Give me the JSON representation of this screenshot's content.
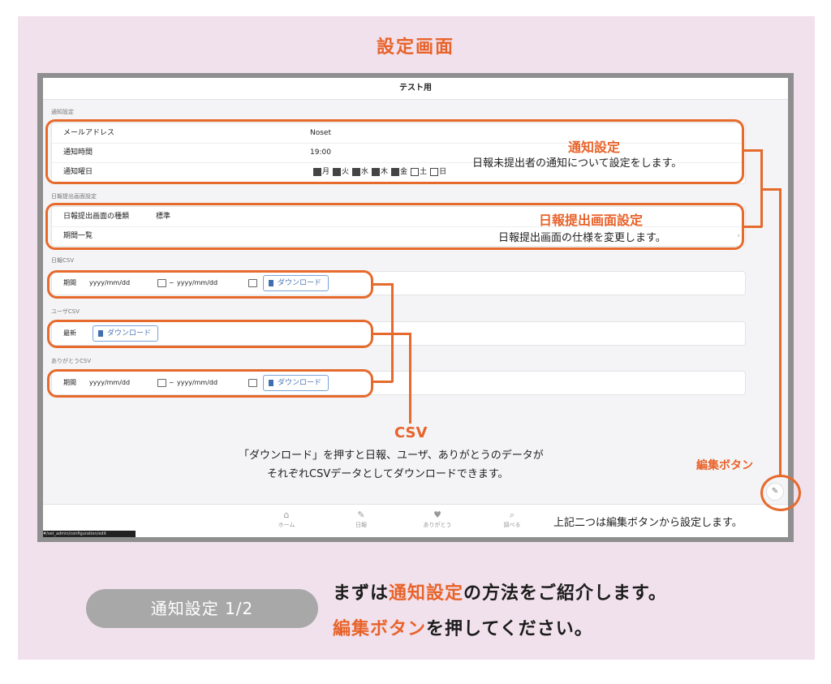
{
  "page_title": "設定画面",
  "colors": {
    "accent": "#e8632a",
    "panel": "#f1e1ec",
    "frame": "#8f8f8f"
  },
  "app": {
    "header_title": "テスト用",
    "notification": {
      "section_label": "通知設定",
      "rows": [
        {
          "label": "メールアドレス",
          "value": "Noset"
        },
        {
          "label": "通知時間",
          "value": "19:00"
        },
        {
          "label": "通知曜日",
          "days": [
            {
              "day": "月",
              "checked": true
            },
            {
              "day": "火",
              "checked": true
            },
            {
              "day": "水",
              "checked": true
            },
            {
              "day": "木",
              "checked": true
            },
            {
              "day": "金",
              "checked": true
            },
            {
              "day": "土",
              "checked": false
            },
            {
              "day": "日",
              "checked": false
            }
          ]
        }
      ]
    },
    "report_screen": {
      "section_label": "日報提出画面設定",
      "type_label": "日報提出画面の種類",
      "type_value": "標準",
      "period_list_label": "期間一覧",
      "chevron": "›"
    },
    "csv": {
      "date_placeholder": "yyyy/mm/dd",
      "tilde": "~",
      "download_label": "ダウンロード",
      "daily": {
        "section_label": "日報CSV",
        "row_label": "期間"
      },
      "user": {
        "section_label": "ユーザCSV",
        "row_label": "最新"
      },
      "thanks": {
        "section_label": "ありがとうCSV",
        "row_label": "期間"
      }
    },
    "bottom_nav": [
      {
        "icon": "home-icon",
        "glyph": "⌂",
        "label": "ホーム"
      },
      {
        "icon": "report-icon",
        "glyph": "✎",
        "label": "日報"
      },
      {
        "icon": "heart-icon",
        "glyph": "♥",
        "label": "ありがとう"
      },
      {
        "icon": "search-icon",
        "glyph": "⌕",
        "label": "調べる"
      }
    ],
    "url_fragment": "#/set_admin/configuration/edit",
    "edit_icon_glyph": "✎"
  },
  "annotations": {
    "notification_title": "通知設定",
    "notification_desc": "日報未提出者の通知について設定をします。",
    "report_title": "日報提出画面設定",
    "report_desc": "日報提出画面の仕様を変更します。",
    "csv_title": "CSV",
    "csv_desc_1": "「ダウンロード」を押すと日報、ユーザ、ありがとうのデータが",
    "csv_desc_2": "それぞれCSVデータとしてダウンロードできます。",
    "edit_button_label": "編集ボタン",
    "edit_note": "上記二つは編集ボタンから設定します。"
  },
  "footer": {
    "step_badge": "通知設定 1/2",
    "line1_prefix": "まずは",
    "line1_highlight": "通知設定",
    "line1_suffix": "の方法をご紹介します。",
    "line2_highlight": "編集ボタン",
    "line2_suffix": "を押してください。"
  }
}
